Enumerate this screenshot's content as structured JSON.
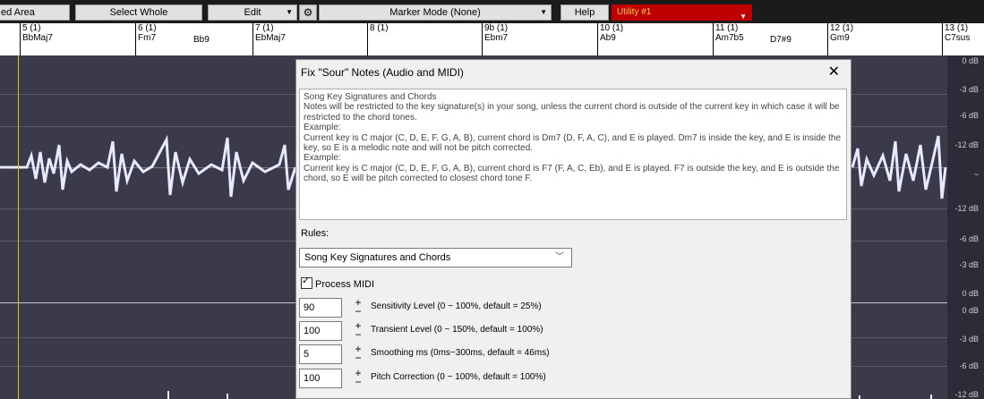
{
  "toolbar": {
    "area_label": "ed Area",
    "select_whole": "Select Whole",
    "edit": "Edit",
    "marker_mode": "Marker Mode (None)",
    "help": "Help",
    "utility": "Utility #1"
  },
  "ruler": {
    "bars": [
      {
        "num": "5 (1)",
        "chord": "BbMaj7"
      },
      {
        "num": "6 (1)",
        "chord": "Fm7"
      },
      {
        "num": "7 (1)",
        "chord": "EbMaj7"
      },
      {
        "num": "8 (1)",
        "chord": ""
      },
      {
        "num": "9b (1)",
        "chord": "Ebm7"
      },
      {
        "num": "10 (1)",
        "chord": "Ab9"
      },
      {
        "num": "11 (1)",
        "chord": "Am7b5"
      },
      {
        "num": "12 (1)",
        "chord": "Gm9"
      },
      {
        "num": "13 (1)",
        "chord": "C7sus"
      }
    ],
    "extra_chords": [
      "Bb9",
      "D7#9"
    ]
  },
  "db_labels": [
    "0 dB",
    "-3 dB",
    "-6 dB",
    "-12 dB",
    "~",
    "-12 dB",
    "-6 dB",
    "-3 dB",
    "0 dB",
    "0 dB",
    "-3 dB",
    "-6 dB",
    "-12 dB"
  ],
  "dialog": {
    "title": "Fix \"Sour\" Notes (Audio and MIDI)",
    "help_lines": [
      "Song Key Signatures and Chords",
      "Notes will be restricted to the key signature(s) in your song, unless the current chord is outside of the current key in which case it will be restricted to the chord tones.",
      "Example:",
      "Current key is C major (C, D, E, F, G, A, B), current chord is Dm7 (D, F, A, C), and E is played. Dm7 is inside the key, and E is inside the key, so E is a melodic note and will not be pitch corrected.",
      "Example:",
      "Current key is C major (C, D, E, F, G, A, B), current chord is F7 (F, A, C, Eb), and E is played. F7 is outside the key, and E is outside the chord, so E will be pitch corrected to closest chord tone F."
    ],
    "rules_label": "Rules:",
    "rules_value": "Song Key Signatures and Chords",
    "process_midi": "Process MIDI",
    "params": [
      {
        "value": "90",
        "label": "Sensitivity Level  (0 ~ 100%, default = 25%)"
      },
      {
        "value": "100",
        "label": "Transient Level    (0 ~ 150%, default = 100%)"
      },
      {
        "value": "5",
        "label": "Smoothing ms      (0ms~300ms, default = 46ms)"
      },
      {
        "value": "100",
        "label": "Pitch Correction  (0 ~ 100%, default = 100%)"
      }
    ]
  },
  "colors": {
    "waveform": "#e8e8ff",
    "background": "#3a3a4a",
    "utility": "#c00000"
  }
}
